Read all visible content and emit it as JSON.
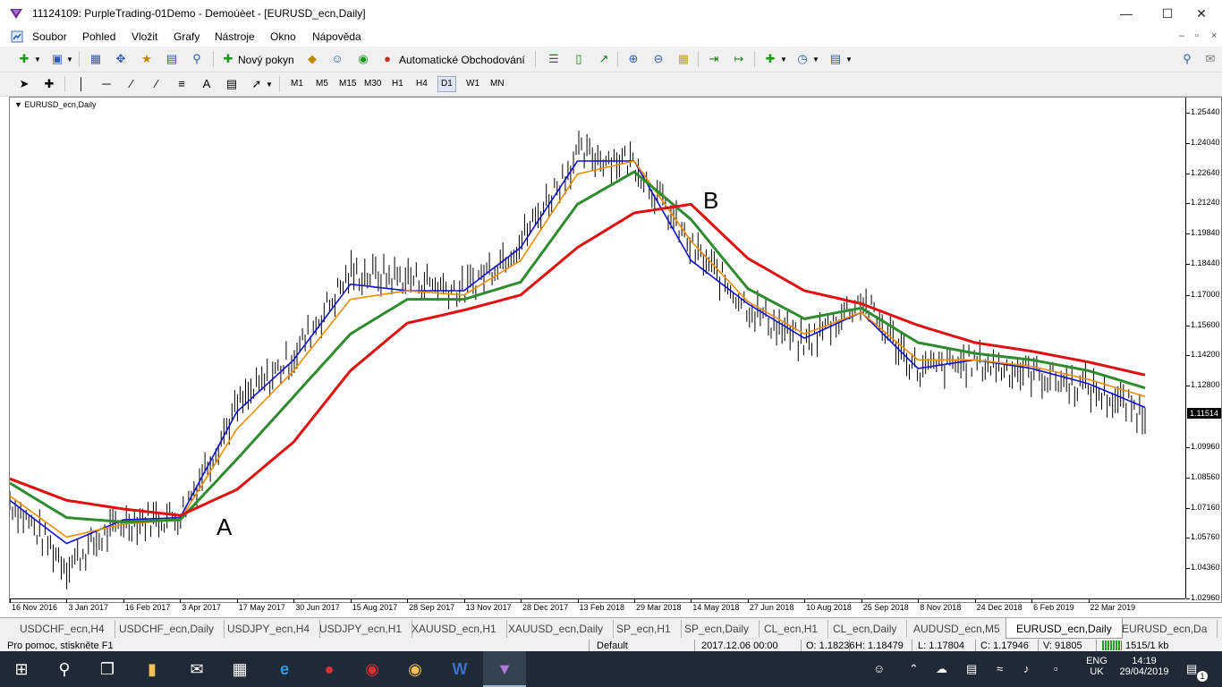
{
  "window": {
    "title": "11124109: PurpleTrading-01Demo - Demoúèet - [EURUSD_ecn,Daily]",
    "minimize_icon": "minimize-icon",
    "maximize_icon": "maximize-icon",
    "close_icon": "close-icon"
  },
  "menu": {
    "items": [
      "Soubor",
      "Pohled",
      "Vložit",
      "Grafy",
      "Nástroje",
      "Okno",
      "Nápověda"
    ]
  },
  "toolbar": {
    "new_order_label": "Nový pokyn",
    "auto_trading_label": "Automatické Obchodování",
    "timeframes": [
      "M1",
      "M5",
      "M15",
      "M30",
      "H1",
      "H4",
      "D1",
      "W1",
      "MN"
    ],
    "active_timeframe": "D1"
  },
  "chart": {
    "symbol_label": "EURUSD_ecn,Daily",
    "annotation_a": "A",
    "annotation_b": "B",
    "current_price": "1.11514",
    "price_labels": [
      "1.25440",
      "1.24040",
      "1.22640",
      "1.21240",
      "1.19840",
      "1.18440",
      "1.17000",
      "1.15600",
      "1.14200",
      "1.12800",
      "1.09960",
      "1.08560",
      "1.07160",
      "1.05760",
      "1.04360",
      "1.02960"
    ],
    "date_labels": [
      "16 Nov 2016",
      "3 Jan 2017",
      "16 Feb 2017",
      "3 Apr 2017",
      "17 May 2017",
      "30 Jun 2017",
      "15 Aug 2017",
      "28 Sep 2017",
      "13 Nov 2017",
      "28 Dec 2017",
      "13 Feb 2018",
      "29 Mar 2018",
      "14 May 2018",
      "27 Jun 2018",
      "10 Aug 2018",
      "25 Sep 2018",
      "8 Nov 2018",
      "24 Dec 2018",
      "6 Feb 2019",
      "22 Mar 2019"
    ],
    "colors": {
      "price_bars": "#000000",
      "ma_fast": "#1010d0",
      "ma_medium": "#f08c00",
      "ma_slow": "#2e8b2e",
      "ma_long": "#e01010"
    }
  },
  "chart_data": {
    "type": "line",
    "title": "EURUSD_ecn,Daily",
    "xlabel": "",
    "ylabel": "",
    "ylim": [
      1.0296,
      1.2614
    ],
    "x": [
      "16 Nov 2016",
      "3 Jan 2017",
      "16 Feb 2017",
      "3 Apr 2017",
      "17 May 2017",
      "30 Jun 2017",
      "15 Aug 2017",
      "28 Sep 2017",
      "13 Nov 2017",
      "28 Dec 2017",
      "13 Feb 2018",
      "29 Mar 2018",
      "14 May 2018",
      "27 Jun 2018",
      "10 Aug 2018",
      "25 Sep 2018",
      "8 Nov 2018",
      "24 Dec 2018",
      "6 Feb 2019",
      "22 Mar 2019",
      "26 Apr 2019"
    ],
    "price": [
      1.075,
      1.045,
      1.065,
      1.068,
      1.118,
      1.142,
      1.18,
      1.178,
      1.172,
      1.195,
      1.235,
      1.232,
      1.192,
      1.165,
      1.147,
      1.168,
      1.135,
      1.139,
      1.134,
      1.127,
      1.115
    ],
    "series": [
      {
        "name": "",
        "color": "#1010d0",
        "values": [
          1.075,
          1.055,
          1.066,
          1.067,
          1.116,
          1.14,
          1.175,
          1.172,
          1.172,
          1.192,
          1.232,
          1.232,
          1.186,
          1.166,
          1.15,
          1.162,
          1.136,
          1.14,
          1.136,
          1.129,
          1.118
        ]
      },
      {
        "name": "",
        "color": "#f08c00",
        "values": [
          1.077,
          1.058,
          1.064,
          1.066,
          1.108,
          1.135,
          1.168,
          1.172,
          1.17,
          1.186,
          1.226,
          1.232,
          1.195,
          1.167,
          1.152,
          1.162,
          1.14,
          1.14,
          1.137,
          1.131,
          1.123
        ]
      },
      {
        "name": "",
        "color": "#2e8b2e",
        "values": [
          1.083,
          1.067,
          1.065,
          1.066,
          1.094,
          1.123,
          1.152,
          1.168,
          1.168,
          1.176,
          1.212,
          1.227,
          1.205,
          1.173,
          1.159,
          1.164,
          1.148,
          1.143,
          1.14,
          1.135,
          1.127
        ]
      },
      {
        "name": "",
        "color": "#e01010",
        "values": [
          1.085,
          1.075,
          1.071,
          1.068,
          1.08,
          1.102,
          1.135,
          1.157,
          1.163,
          1.17,
          1.192,
          1.208,
          1.212,
          1.187,
          1.172,
          1.166,
          1.156,
          1.148,
          1.144,
          1.139,
          1.133
        ]
      }
    ],
    "annotations": [
      {
        "text": "A",
        "x": "3 Apr 2017",
        "y": 1.06
      },
      {
        "text": "B",
        "x": "29 Mar 2018",
        "y": 1.222
      }
    ]
  },
  "tabs": {
    "items": [
      "USDCHF_ecn,H4",
      "USDCHF_ecn,Daily",
      "USDJPY_ecn,H4",
      "USDJPY_ecn,H1",
      "XAUUSD_ecn,H1",
      "XAUUSD_ecn,Daily",
      "SP_ecn,H1",
      "SP_ecn,Daily",
      "CL_ecn,H1",
      "CL_ecn,Daily",
      "AUDUSD_ecn,M5",
      "EURUSD_ecn,Daily",
      "EURUSD_ecn,Da"
    ],
    "active": "EURUSD_ecn,Daily"
  },
  "status": {
    "help": "Pro pomoc, stiskněte F1",
    "profile": "Default",
    "datetime": "2017.12.06 00:00",
    "open": "O: 1.18236",
    "high": "H: 1.18479",
    "low": "L: 1.17804",
    "close": "C: 1.17946",
    "volume": "V: 91805",
    "traffic": "1515/1 kb"
  },
  "taskbar": {
    "language": "ENG",
    "region": "UK",
    "time": "14:19",
    "date": "29/04/2019",
    "notification_count": "1"
  }
}
